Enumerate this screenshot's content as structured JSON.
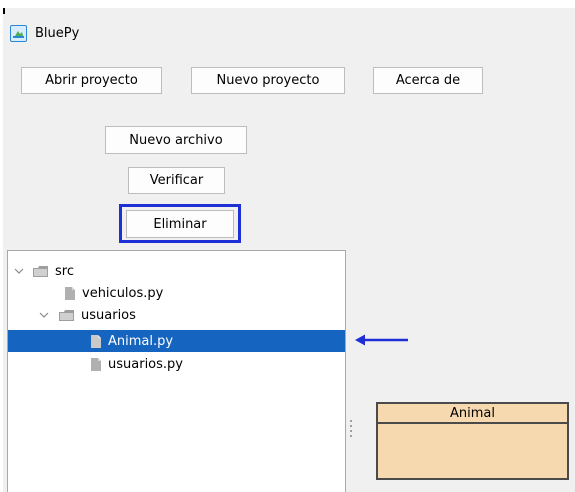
{
  "window": {
    "title": "BluePy",
    "icon": "app-icon"
  },
  "toolbar": {
    "open_label": "Abrir proyecto",
    "new_project_label": "Nuevo proyecto",
    "about_label": "Acerca de"
  },
  "actions": {
    "new_file_label": "Nuevo archivo",
    "verify_label": "Verificar",
    "delete_label": "Eliminar"
  },
  "tree": {
    "root": {
      "label": "src",
      "expanded": true
    },
    "items": [
      {
        "label": "vehiculos.py",
        "type": "file"
      },
      {
        "label": "usuarios",
        "type": "folder",
        "expanded": true
      },
      {
        "label": "Animal.py",
        "type": "file",
        "selected": true
      },
      {
        "label": "usuarios.py",
        "type": "file"
      }
    ]
  },
  "diagram": {
    "class_name": "Animal"
  },
  "colors": {
    "selection": "#1565c0",
    "highlight_border": "#1f2fd6",
    "arrow": "#1f2fd6",
    "uml_fill": "#f7d9b0",
    "window_bg": "#f0f0f0"
  }
}
